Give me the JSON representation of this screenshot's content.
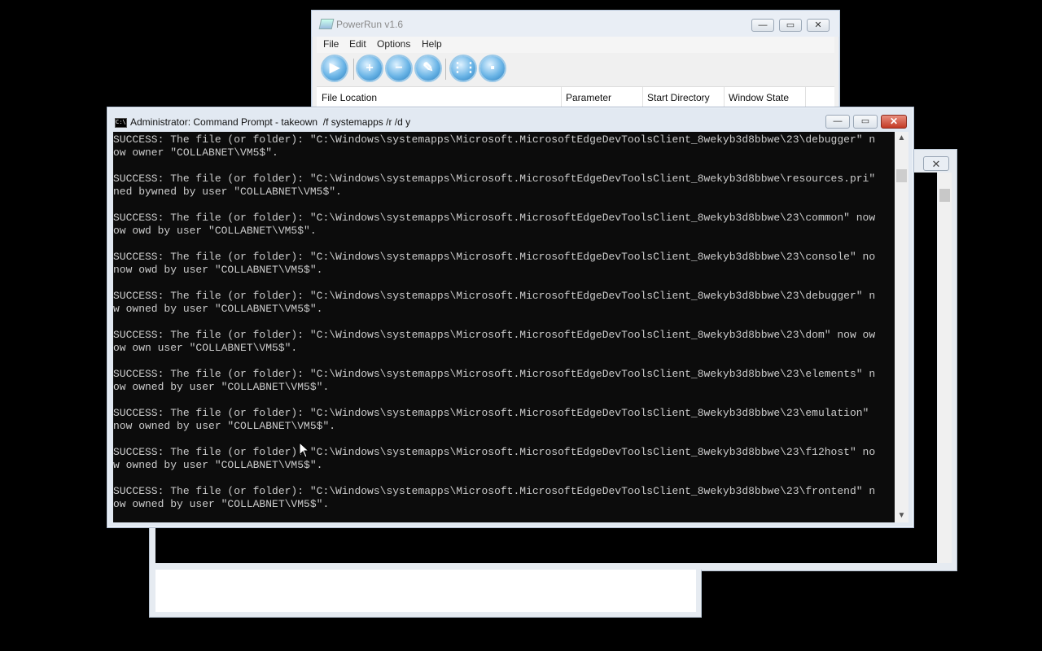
{
  "powerrun": {
    "title": "PowerRun v1.6",
    "menu": [
      "File",
      "Edit",
      "Options",
      "Help"
    ],
    "toolbar_icons": [
      "run-icon",
      "add-icon",
      "remove-icon",
      "edit-icon",
      "grid-icon",
      "console-icon"
    ],
    "columns": [
      "File Location",
      "Parameter",
      "Start Directory",
      "Window State"
    ],
    "caption_buttons": {
      "minimize": "—",
      "maximize": "▭",
      "close": "✕"
    }
  },
  "bg_window": {
    "close": "✕"
  },
  "cmd": {
    "title": "Administrator: Command Prompt - takeown  /f systemapps /r /d y",
    "caption_buttons": {
      "minimize": "—",
      "maximize": "▭",
      "close": "✕"
    },
    "lines": [
      "SUCCESS: The file (or folder): \"C:\\Windows\\systemapps\\Microsoft.MicrosoftEdgeDevToolsClient_8wekyb3d8bbwe\\23\\debugger\" n",
      "ow owner \"COLLABNET\\VM5$\".",
      "",
      "SUCCESS: The file (or folder): \"C:\\Windows\\systemapps\\Microsoft.MicrosoftEdgeDevToolsClient_8wekyb3d8bbwe\\resources.pri\"",
      "ned bywned by user \"COLLABNET\\VM5$\".",
      "",
      "SUCCESS: The file (or folder): \"C:\\Windows\\systemapps\\Microsoft.MicrosoftEdgeDevToolsClient_8wekyb3d8bbwe\\23\\common\" now",
      "ow owd by user \"COLLABNET\\VM5$\".",
      "",
      "SUCCESS: The file (or folder): \"C:\\Windows\\systemapps\\Microsoft.MicrosoftEdgeDevToolsClient_8wekyb3d8bbwe\\23\\console\" no",
      "now owd by user \"COLLABNET\\VM5$\".",
      "",
      "SUCCESS: The file (or folder): \"C:\\Windows\\systemapps\\Microsoft.MicrosoftEdgeDevToolsClient_8wekyb3d8bbwe\\23\\debugger\" n",
      "w owned by user \"COLLABNET\\VM5$\".",
      "",
      "SUCCESS: The file (or folder): \"C:\\Windows\\systemapps\\Microsoft.MicrosoftEdgeDevToolsClient_8wekyb3d8bbwe\\23\\dom\" now ow",
      "ow own user \"COLLABNET\\VM5$\".",
      "",
      "SUCCESS: The file (or folder): \"C:\\Windows\\systemapps\\Microsoft.MicrosoftEdgeDevToolsClient_8wekyb3d8bbwe\\23\\elements\" n",
      "ow owned by user \"COLLABNET\\VM5$\".",
      "",
      "SUCCESS: The file (or folder): \"C:\\Windows\\systemapps\\Microsoft.MicrosoftEdgeDevToolsClient_8wekyb3d8bbwe\\23\\emulation\"",
      "now owned by user \"COLLABNET\\VM5$\".",
      "",
      "SUCCESS: The file (or folder): \"C:\\Windows\\systemapps\\Microsoft.MicrosoftEdgeDevToolsClient_8wekyb3d8bbwe\\23\\f12host\" no",
      "w owned by user \"COLLABNET\\VM5$\".",
      "",
      "SUCCESS: The file (or folder): \"C:\\Windows\\systemapps\\Microsoft.MicrosoftEdgeDevToolsClient_8wekyb3d8bbwe\\23\\frontend\" n",
      "ow owned by user \"COLLABNET\\VM5$\"."
    ]
  }
}
